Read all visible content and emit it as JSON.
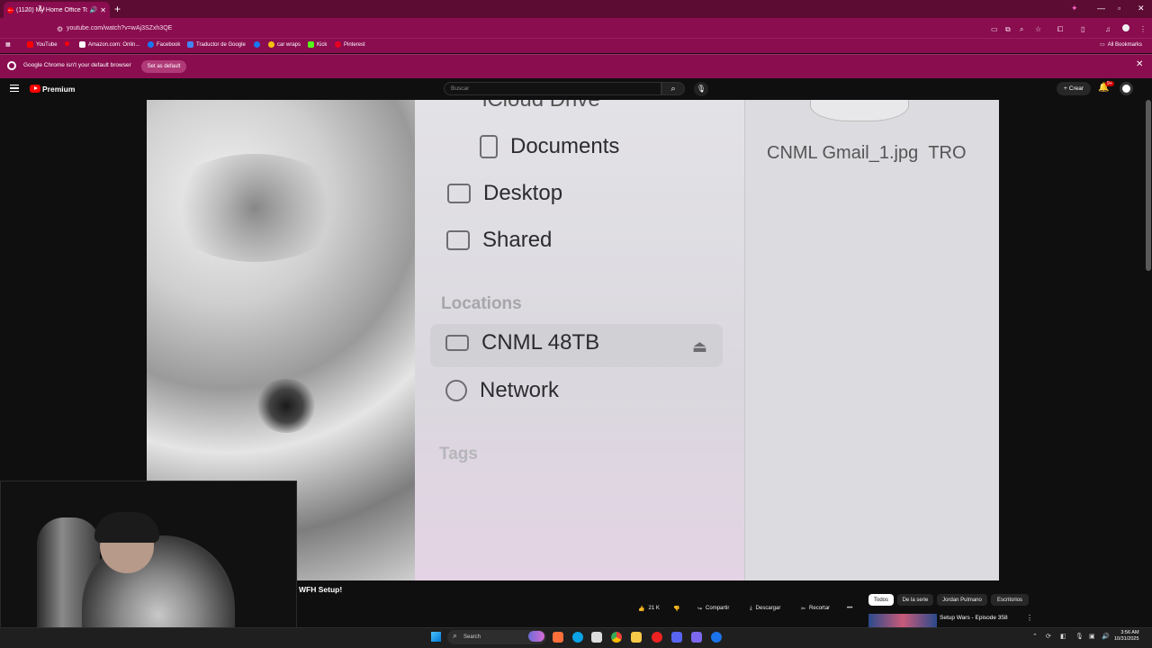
{
  "browser": {
    "tab_title": "(1120) My Home Office To...",
    "url": "youtube.com/watch?v=wAj3SZxh3QE",
    "bookmarks": [
      "YouTube",
      "Amazon.com: Onlin...",
      "Facebook",
      "Traductor de Google",
      "car wraps",
      "Kick",
      "Pinterest"
    ],
    "all_bookmarks": "All Bookmarks",
    "infobar_text": "Google Chrome isn't your default browser",
    "set_default": "Set as default"
  },
  "youtube": {
    "brand": "Premium",
    "search_placeholder": "Buscar",
    "create_label": "Crear",
    "notif_badge": "9+"
  },
  "video_frame": {
    "finder_items": [
      {
        "label": "iCloud Drive"
      },
      {
        "label": "Documents"
      },
      {
        "label": "Desktop"
      },
      {
        "label": "Shared"
      }
    ],
    "locations_header": "Locations",
    "locations": [
      {
        "label": "CNML 48TB"
      },
      {
        "label": "Network"
      }
    ],
    "tags_header": "Tags",
    "file_name": "CNML Gmail_1.jpg",
    "file_name_2": "TRO"
  },
  "video": {
    "title": "WFH Setup!",
    "likes": "21 K",
    "share": "Compartir",
    "download": "Descargar",
    "clip": "Recortar"
  },
  "chips": [
    "Todos",
    "De la serie",
    "Jordan Pulmano",
    "Escritorios"
  ],
  "recommended": {
    "title": "Setup Wars - Episode 358"
  },
  "taskbar": {
    "search_placeholder": "Search",
    "time": "3:56 AM",
    "date": "10/31/2025"
  }
}
